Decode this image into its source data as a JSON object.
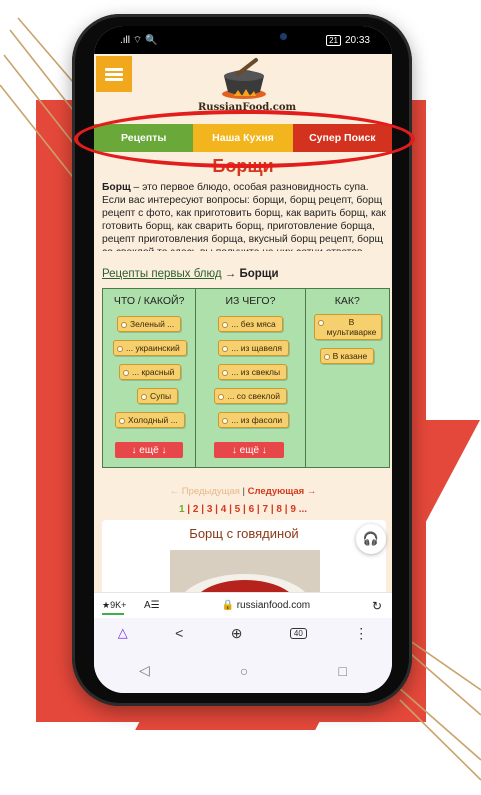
{
  "status_bar": {
    "left": ".ıll ⌔ 🔍",
    "battery": "21",
    "time": "20:33"
  },
  "site": {
    "logo_text": "RussianFood.com",
    "nav": [
      "Рецепты",
      "Наша Кухня",
      "Супер Поиск"
    ]
  },
  "page_title": "Борщи",
  "intro": {
    "bold": "Борщ",
    "text": " – это первое блюдо, особая разновидность супа. Если вас интересуют вопросы: борщи, борщ рецепт, борщ рецепт с фото, как приготовить борщ, как варить борщ, как готовить борщ, как сварить борщ, приготовление борща, рецепт приготовления борща, вкусный борщ рецепт, борщ со свеклой то здесь вы получите на них сотни ответов"
  },
  "breadcrumb": {
    "link": "Рецепты первых блюд",
    "arrow": "→",
    "current": "Борщи"
  },
  "filters": {
    "headers": [
      "ЧТО / КАКОЙ?",
      "ИЗ ЧЕГО?",
      "КАК?"
    ],
    "what": [
      "Зеленый ...",
      "... украинский",
      "... красный",
      "Супы",
      "Холодный ..."
    ],
    "from": [
      "... без мяса",
      "... из щавеля",
      "... из свеклы",
      "... со свеклой",
      "... из фасоли"
    ],
    "how": [
      "В мультиварке",
      "В казане"
    ],
    "more_label": "↓ ещё ↓"
  },
  "pager": {
    "prev": "← Предыдущая",
    "sep": " | ",
    "next": "Следующая →",
    "pages": [
      "1",
      "2",
      "3",
      "4",
      "5",
      "6",
      "7",
      "8",
      "9",
      "..."
    ]
  },
  "card": {
    "title": "Борщ с говядиной"
  },
  "browser": {
    "rating": "★9K+",
    "reader": "A☰",
    "domain": "🔒 russianfood.com",
    "reload": "↻",
    "tab_count": "40"
  },
  "colors": {
    "accent_red": "#d6381e",
    "nav_green": "#6aa83a",
    "nav_yellow": "#f2b51d",
    "nav_red": "#d2321e",
    "filter_bg": "#aee0ab"
  }
}
